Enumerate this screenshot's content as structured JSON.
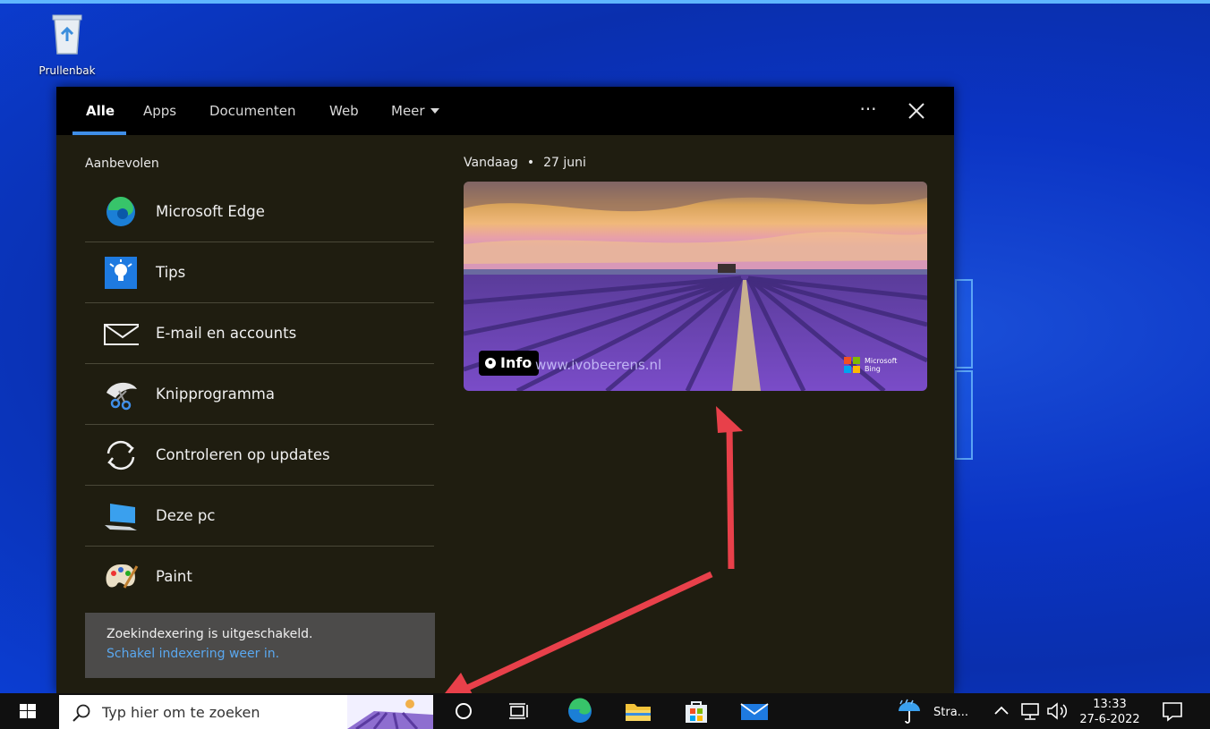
{
  "desktop": {
    "recycle_bin_label": "Prullenbak"
  },
  "search_panel": {
    "tabs": [
      {
        "label": "Alle",
        "active": true
      },
      {
        "label": "Apps"
      },
      {
        "label": "Documenten"
      },
      {
        "label": "Web"
      },
      {
        "label": "Meer"
      }
    ],
    "more_options_label": "···",
    "recommended_title": "Aanbevolen",
    "recommended": [
      {
        "label": "Microsoft Edge",
        "icon": "edge-icon"
      },
      {
        "label": "Tips",
        "icon": "lightbulb-icon"
      },
      {
        "label": "E-mail en accounts",
        "icon": "envelope-icon"
      },
      {
        "label": "Knipprogramma",
        "icon": "scissors-icon"
      },
      {
        "label": "Controleren op updates",
        "icon": "refresh-icon"
      },
      {
        "label": "Deze pc",
        "icon": "computer-icon"
      },
      {
        "label": "Paint",
        "icon": "palette-icon"
      }
    ],
    "indexing_notice": {
      "text": "Zoekindexering is uitgeschakeld.",
      "link": "Schakel indexering weer in."
    },
    "today": {
      "label": "Vandaag",
      "separator": "•",
      "date": "27 juni",
      "info_label": "Info",
      "watermark": "www.ivobeerens.nl",
      "bing_label_1": "Microsoft",
      "bing_label_2": "Bing"
    }
  },
  "taskbar": {
    "search_placeholder": "Typ hier om te zoeken",
    "weather_label": "Stra...",
    "time": "13:33",
    "date": "27-6-2022"
  },
  "colors": {
    "accent": "#3f8ee8",
    "panel_bg": "#1f1d10",
    "link": "#5aa8f0",
    "annotation_arrow": "#e8404a"
  }
}
